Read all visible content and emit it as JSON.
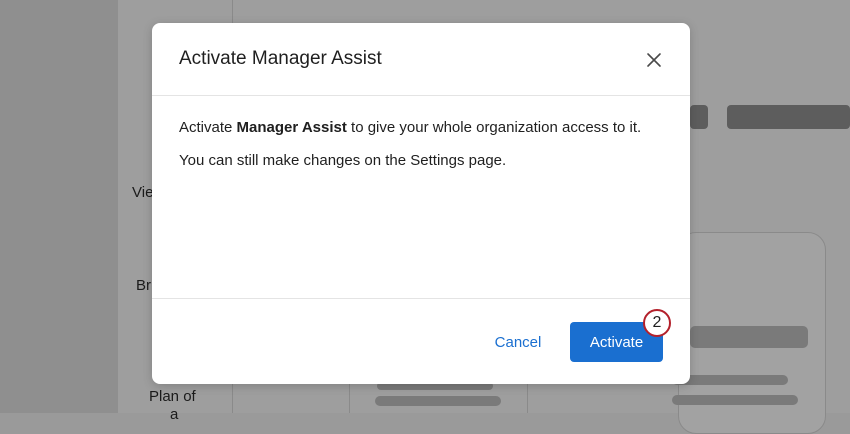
{
  "background": {
    "labels": {
      "view": "Vie",
      "br": "Br",
      "plan_line1": "Plan of",
      "plan_line2": "a"
    }
  },
  "dialog": {
    "title": "Activate Manager Assist",
    "body_prefix": "Activate ",
    "body_bold": "Manager Assist",
    "body_suffix": " to give your whole organization access to it.",
    "body_line2": "You can still make changes on the Settings page.",
    "cancel_label": "Cancel",
    "activate_label": "Activate",
    "close_icon": "close-icon"
  },
  "annotation": {
    "step_number": "2"
  },
  "colors": {
    "primary": "#1a6fd0",
    "badge_border": "#b3202b"
  }
}
